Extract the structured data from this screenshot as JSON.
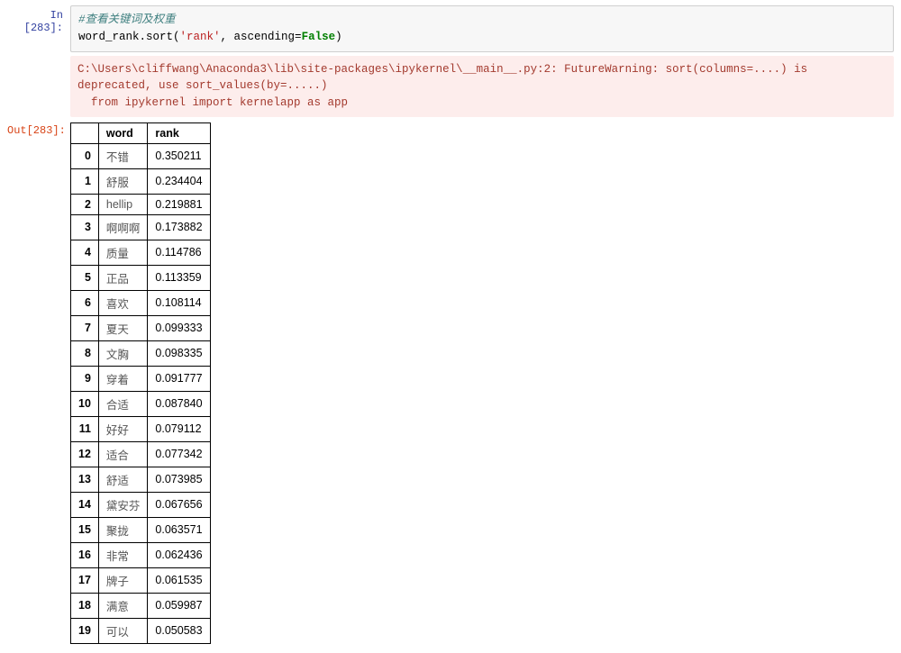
{
  "in_prompt": "In [283]:",
  "out_prompt": "Out[283]:",
  "code": {
    "comment": "#查看关键词及权重",
    "prefix": "word_rank.sort(",
    "arg_str": "'rank'",
    "mid": ", ascending=",
    "kw_false": "False",
    "suffix": ")"
  },
  "warning": {
    "line1": "C:\\Users\\cliffwang\\Anaconda3\\lib\\site-packages\\ipykernel\\__main__.py:2: FutureWarning: sort(columns=....) is deprecated, use sort_values(by=.....)",
    "line2": "  from ipykernel import kernelapp as app"
  },
  "table": {
    "cols": [
      "word",
      "rank"
    ],
    "rows": [
      {
        "idx": "0",
        "word": "不错",
        "rank": "0.350211"
      },
      {
        "idx": "1",
        "word": "舒服",
        "rank": "0.234404"
      },
      {
        "idx": "2",
        "word": "hellip",
        "rank": "0.219881"
      },
      {
        "idx": "3",
        "word": "啊啊啊",
        "rank": "0.173882"
      },
      {
        "idx": "4",
        "word": "质量",
        "rank": "0.114786"
      },
      {
        "idx": "5",
        "word": "正品",
        "rank": "0.113359"
      },
      {
        "idx": "6",
        "word": "喜欢",
        "rank": "0.108114"
      },
      {
        "idx": "7",
        "word": "夏天",
        "rank": "0.099333"
      },
      {
        "idx": "8",
        "word": "文胸",
        "rank": "0.098335"
      },
      {
        "idx": "9",
        "word": "穿着",
        "rank": "0.091777"
      },
      {
        "idx": "10",
        "word": "合适",
        "rank": "0.087840"
      },
      {
        "idx": "11",
        "word": "好好",
        "rank": "0.079112"
      },
      {
        "idx": "12",
        "word": "适合",
        "rank": "0.077342"
      },
      {
        "idx": "13",
        "word": "舒适",
        "rank": "0.073985"
      },
      {
        "idx": "14",
        "word": "黛安芬",
        "rank": "0.067656"
      },
      {
        "idx": "15",
        "word": "聚拢",
        "rank": "0.063571"
      },
      {
        "idx": "16",
        "word": "非常",
        "rank": "0.062436"
      },
      {
        "idx": "17",
        "word": "牌子",
        "rank": "0.061535"
      },
      {
        "idx": "18",
        "word": "满意",
        "rank": "0.059987"
      },
      {
        "idx": "19",
        "word": "可以",
        "rank": "0.050583"
      }
    ]
  }
}
